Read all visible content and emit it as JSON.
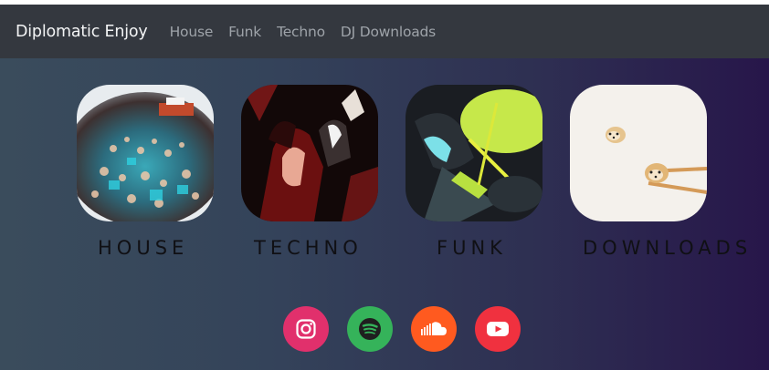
{
  "navbar": {
    "brand": "Diplomatic Enjoy",
    "links": [
      "House",
      "Funk",
      "Techno",
      "DJ Downloads"
    ]
  },
  "genres": [
    {
      "label": "HOUSE",
      "image": "festival-crowd-fisheye"
    },
    {
      "label": "TECHNO",
      "image": "raver-dancers-redlight"
    },
    {
      "label": "FUNK",
      "image": "drummer-neon-green"
    },
    {
      "label": "DOWNLOADS",
      "image": "shiba-dumplings-chopsticks"
    }
  ],
  "social": [
    {
      "name": "instagram-icon",
      "color": "#e1306c"
    },
    {
      "name": "spotify-icon",
      "color": "#35b35a"
    },
    {
      "name": "soundcloud-icon",
      "color": "#ff5a1f"
    },
    {
      "name": "youtube-icon",
      "color": "#f0313f"
    }
  ],
  "colors": {
    "navbar": "#34383f",
    "gradient_start": "#3a4c5c",
    "gradient_end": "#27164a"
  }
}
